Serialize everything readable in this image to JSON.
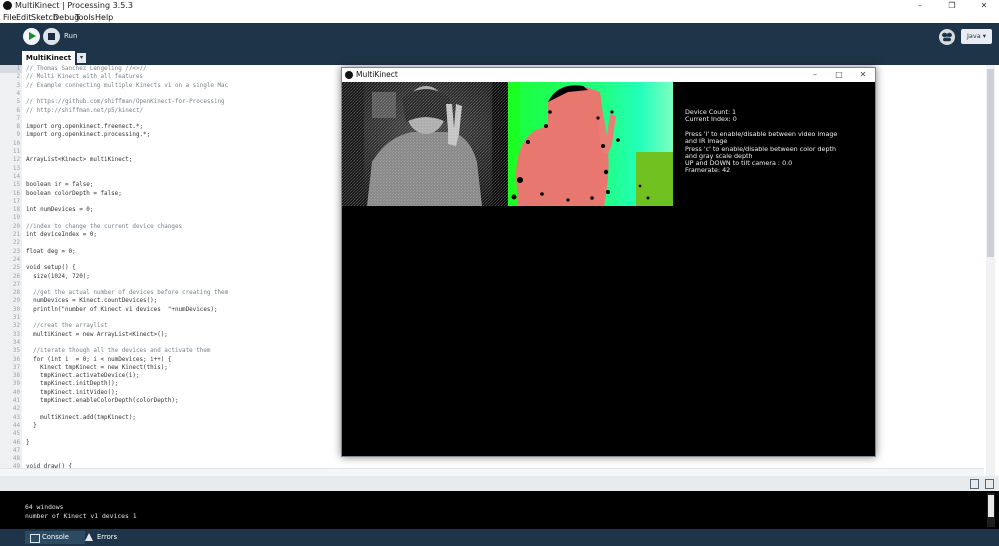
{
  "window": {
    "title": "MultiKinect | Processing 3.5.3",
    "controls": [
      "–",
      "❒",
      "✕"
    ]
  },
  "menu": [
    "File",
    "Edit",
    "Sketch",
    "Debug",
    "Tools",
    "Help"
  ],
  "toolbar": {
    "run_label": "Run",
    "mode_label": "Java ▾"
  },
  "tabs": [
    {
      "label": "MultiKinect",
      "active": true
    }
  ],
  "tab_menu_glyph": "▾",
  "editor": {
    "current_line": 1,
    "lines": [
      {
        "n": "1",
        "text": "// Thomas Sanchez Lengeling //<>//",
        "kind": "comment"
      },
      {
        "n": "2",
        "text": "// Multi Kinect with all features",
        "kind": "comment"
      },
      {
        "n": "3",
        "text": "// Example connecting multiple Kinects v1 on a single Mac",
        "kind": "comment"
      },
      {
        "n": "4",
        "text": "",
        "kind": "code"
      },
      {
        "n": "5",
        "text": "// https://github.com/shiffman/OpenKinect-for-Processing",
        "kind": "comment"
      },
      {
        "n": "6",
        "text": "// http://shiffman.net/p5/kinect/",
        "kind": "comment"
      },
      {
        "n": "7",
        "text": "",
        "kind": "code"
      },
      {
        "n": "8",
        "text": "import org.openkinect.freenect.*;",
        "kind": "code"
      },
      {
        "n": "9",
        "text": "import org.openkinect.processing.*;",
        "kind": "code"
      },
      {
        "n": "10",
        "text": "",
        "kind": "code"
      },
      {
        "n": "11",
        "text": "",
        "kind": "code"
      },
      {
        "n": "12",
        "text": "ArrayList<Kinect> multiKinect;",
        "kind": "code"
      },
      {
        "n": "13",
        "text": "",
        "kind": "code"
      },
      {
        "n": "14",
        "text": "",
        "kind": "code"
      },
      {
        "n": "15",
        "text": "boolean ir = false;",
        "kind": "code"
      },
      {
        "n": "16",
        "text": "boolean colorDepth = false;",
        "kind": "code"
      },
      {
        "n": "17",
        "text": "",
        "kind": "code"
      },
      {
        "n": "18",
        "text": "int numDevices = 0;",
        "kind": "code"
      },
      {
        "n": "19",
        "text": "",
        "kind": "code"
      },
      {
        "n": "20",
        "text": "//index to change the current device changes",
        "kind": "comment"
      },
      {
        "n": "21",
        "text": "int deviceIndex = 0;",
        "kind": "code"
      },
      {
        "n": "22",
        "text": "",
        "kind": "code"
      },
      {
        "n": "23",
        "text": "float deg = 0;",
        "kind": "code"
      },
      {
        "n": "24",
        "text": "",
        "kind": "code"
      },
      {
        "n": "25",
        "text": "void setup() {",
        "kind": "code"
      },
      {
        "n": "26",
        "text": "  size(1024, 720);",
        "kind": "code"
      },
      {
        "n": "27",
        "text": "",
        "kind": "code"
      },
      {
        "n": "28",
        "text": "  //get the actual number of devices before creating them",
        "kind": "comment"
      },
      {
        "n": "29",
        "text": "  numDevices = Kinect.countDevices();",
        "kind": "code"
      },
      {
        "n": "30",
        "text": "  println(\"number of Kinect v1 devices  \"+numDevices);",
        "kind": "code"
      },
      {
        "n": "31",
        "text": "",
        "kind": "code"
      },
      {
        "n": "32",
        "text": "  //creat the arraylist",
        "kind": "comment"
      },
      {
        "n": "33",
        "text": "  multiKinect = new ArrayList<Kinect>();",
        "kind": "code"
      },
      {
        "n": "34",
        "text": "",
        "kind": "code"
      },
      {
        "n": "35",
        "text": "  //iterate though all the devices and activate them",
        "kind": "comment"
      },
      {
        "n": "36",
        "text": "  for (int i  = 0; i < numDevices; i++) {",
        "kind": "code"
      },
      {
        "n": "37",
        "text": "    Kinect tmpKinect = new Kinect(this);",
        "kind": "code"
      },
      {
        "n": "38",
        "text": "    tmpKinect.activateDevice(i);",
        "kind": "code"
      },
      {
        "n": "39",
        "text": "    tmpKinect.initDepth();",
        "kind": "code"
      },
      {
        "n": "40",
        "text": "    tmpKinect.initVideo();",
        "kind": "code"
      },
      {
        "n": "41",
        "text": "    tmpKinect.enableColorDepth(colorDepth);",
        "kind": "code"
      },
      {
        "n": "42",
        "text": "",
        "kind": "code"
      },
      {
        "n": "43",
        "text": "    multiKinect.add(tmpKinect);",
        "kind": "code"
      },
      {
        "n": "44",
        "text": "  }",
        "kind": "code"
      },
      {
        "n": "45",
        "text": "",
        "kind": "code"
      },
      {
        "n": "46",
        "text": "}",
        "kind": "code"
      },
      {
        "n": "47",
        "text": "",
        "kind": "code"
      },
      {
        "n": "48",
        "text": "",
        "kind": "code"
      },
      {
        "n": "49",
        "text": "void draw() {",
        "kind": "code"
      }
    ]
  },
  "sketch_window": {
    "title": "MultiKinect",
    "controls": [
      "–",
      "□",
      "✕"
    ],
    "info_lines": [
      "Device Count: 1",
      "Current Index: 0",
      "",
      "Press 'i' to enable/disable between video image",
      "and IR image",
      "Press 'c' to enable/disable between color depth",
      "and gray scale depth",
      "UP and DOWN to tilt camera : 0.0",
      "Framerate: 42"
    ]
  },
  "console": {
    "lines": [
      "64 windows",
      "number of Kinect v1 devices  1"
    ]
  },
  "bottom_tabs": [
    {
      "label": "Console",
      "active": true
    },
    {
      "label": "Errors",
      "active": false
    }
  ],
  "colors": {
    "toolbar_bg": "#1e3448",
    "run_green": "#1c8a2e",
    "comment": "#7a8188",
    "depth_near": "#e8776f",
    "depth_far": "#19ff4e"
  }
}
